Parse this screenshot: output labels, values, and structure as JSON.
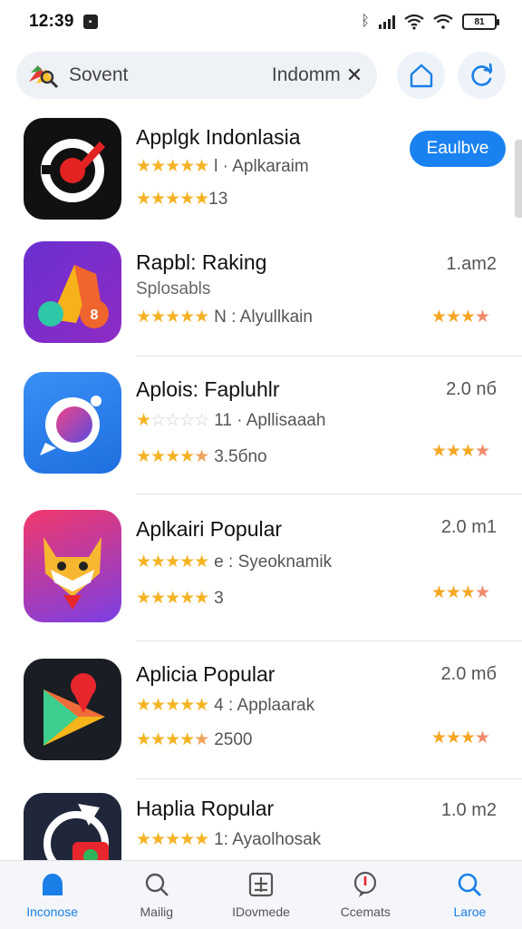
{
  "status": {
    "time": "12:39",
    "battery": "81"
  },
  "search": {
    "left_text": "Sovent",
    "right_text": "Indomm",
    "clear": "✕"
  },
  "apps": [
    {
      "name": "Applgk Indonlasia",
      "rating_meta": "l · Aplkaraim",
      "rating2": "13",
      "action": "Eaulbve"
    },
    {
      "name": "Rapbl: Raking",
      "subtitle": "Splosabls",
      "rating_meta": "N : Alyullkain",
      "size": "1.am2"
    },
    {
      "name": "Aplois: Fapluhlr",
      "rating_meta": "11 · Apllisaaah",
      "rating2": "3.5бno",
      "size": "2.0 nб"
    },
    {
      "name": "Aplkairi Popular",
      "rating_meta": "e : Syeoknamik",
      "rating2": "3",
      "size": "2.0 m1"
    },
    {
      "name": "Aplicia Popular",
      "rating_meta": "4 : Applaarak",
      "rating2": "2500",
      "size": "2.0 mб"
    },
    {
      "name": "Haplia Ropular",
      "rating_meta": "1: Ayaolhosak",
      "size": "1.0 m2"
    }
  ],
  "tabs": [
    {
      "label": "Inconose"
    },
    {
      "label": "Mailig"
    },
    {
      "label": "IDovmede"
    },
    {
      "label": "Ccemats"
    },
    {
      "label": "Laroe"
    }
  ],
  "colors": {
    "accent": "#1a82f0",
    "star": "#f5b324"
  }
}
